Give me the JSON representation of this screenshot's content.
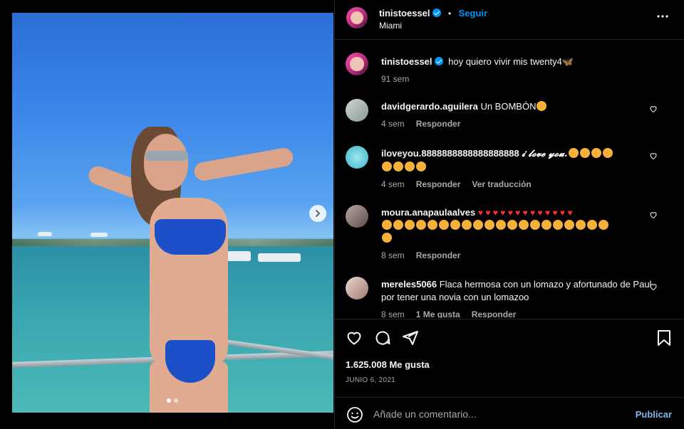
{
  "post": {
    "username": "tinistoessel",
    "follow_label": "Seguir",
    "location": "Miami",
    "more_label": "...",
    "caption": "hoy quiero vivir mis twenty4",
    "caption_time": "91 sem"
  },
  "comments": [
    {
      "username": "davidgerardo.aguilera",
      "text": "Un BOMBÓN",
      "time": "4 sem",
      "reply_label": "Responder",
      "translate_label": "",
      "likes_label": ""
    },
    {
      "username": "iloveyou.8888888888888888888",
      "text": "𝓲 𝓵𝓸𝓿𝓮 𝔂𝓸𝓾.",
      "time": "4 sem",
      "reply_label": "Responder",
      "translate_label": "Ver traducción",
      "likes_label": ""
    },
    {
      "username": "moura.anapaulaalves",
      "text": "",
      "time": "8 sem",
      "reply_label": "Responder",
      "translate_label": "",
      "likes_label": ""
    },
    {
      "username": "mereles5066",
      "text": "Flaca hermosa con un lomazo y afortunado de Paul por tener una novia con un lomazoo",
      "time": "8 sem",
      "reply_label": "Responder",
      "translate_label": "",
      "likes_label": "1 Me gusta"
    }
  ],
  "stats": {
    "likes": "1.625.008 Me gusta",
    "date": "JUNIO 6, 2021"
  },
  "add_comment": {
    "placeholder": "Añade un comentario...",
    "publish_label": "Publicar"
  },
  "colors": {
    "accent": "#0095f6",
    "publish": "#85b4f2",
    "background": "#000000"
  },
  "carousel": {
    "total": 2,
    "current": 1
  }
}
